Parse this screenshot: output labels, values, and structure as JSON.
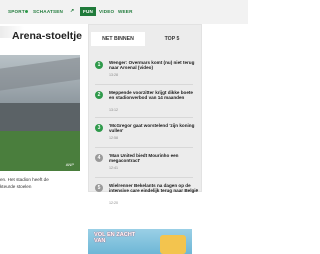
{
  "nav": {
    "items": [
      {
        "label": "SPORT",
        "active": false,
        "has_sep": true
      },
      {
        "label": "SCHAATSEN",
        "active": false,
        "has_sep": false
      },
      {
        "label": "FUN",
        "active": true,
        "has_sep": false
      },
      {
        "label": "VIDEO",
        "active": false,
        "has_sep": false
      },
      {
        "label": "WEER",
        "active": false,
        "has_sep": false
      }
    ],
    "schaatsen_icon": "external-link-icon"
  },
  "article": {
    "title": "Arena-stoeltje",
    "photo_credit": "ANP",
    "caption_line1": "en. Het stadion heeft de",
    "caption_line2": "kteurde stoelen"
  },
  "sidebar": {
    "tabs": [
      {
        "label": "NET BINNEN",
        "selected": true
      },
      {
        "label": "TOP 5",
        "selected": false
      }
    ],
    "news": [
      {
        "num": "1",
        "text": "Wenger: Overmars komt (nu) niet terug naar Arsenal (video)",
        "time": "13:28",
        "color": "#2f9a4b"
      },
      {
        "num": "2",
        "text": "Meppende voorzitter krijgt dikke boete en stadionverbod van 14 maanden",
        "time": "13:12",
        "color": "#2f9a4b"
      },
      {
        "num": "3",
        "text": "'McGregor gaat worstelend 'zijn koning vullen'",
        "time": "12:58",
        "color": "#2f9a4b"
      },
      {
        "num": "4",
        "text": "'Man United biedt Mourinho een megacontract'",
        "time": "12:41",
        "color": "#9a9a9a"
      },
      {
        "num": "5",
        "text": "Wielrenner Bekelants na dagen op de intensive care eindelijk terug naar België",
        "time": "12:20",
        "color": "#9a9a9a"
      }
    ]
  },
  "ad": {
    "text": "VOL EN ZACHT VAN"
  }
}
